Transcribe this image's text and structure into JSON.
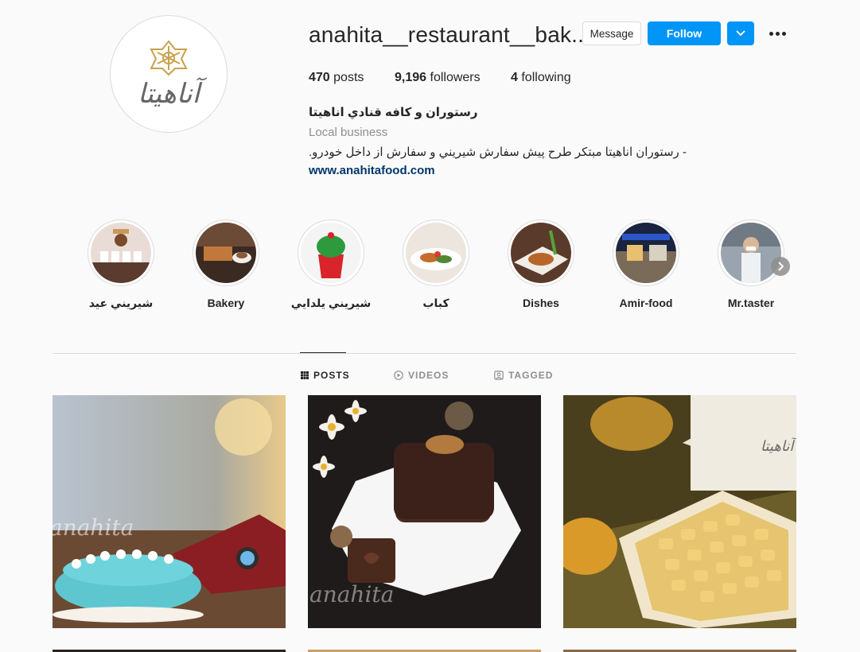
{
  "profile": {
    "username": "anahita__restaurant__bak...",
    "avatar_logo_text": "آناهیتا",
    "message_label": "Message",
    "follow_label": "Follow",
    "stats": {
      "posts_count": "470",
      "posts_label": "posts",
      "followers_count": "9,196",
      "followers_label": "followers",
      "following_count": "4",
      "following_label": "following"
    },
    "bio": {
      "name": "رستوران و كافه قنادي اناهيتا",
      "category": "Local business",
      "text": "- رستوران اناهيتا مبتكر طرح پيش سفارش شيريني و سفارش از داخل خودرو.",
      "link": "www.anahitafood.com"
    }
  },
  "highlights": [
    {
      "label": "شيريني عيد"
    },
    {
      "label": "Bakery"
    },
    {
      "label": "شيريني يلدايي"
    },
    {
      "label": "كباب"
    },
    {
      "label": "Dishes"
    },
    {
      "label": "Amir-food"
    },
    {
      "label": "Mr.taster"
    }
  ],
  "tabs": [
    {
      "label": "POSTS",
      "icon": "grid-icon",
      "active": true
    },
    {
      "label": "VIDEOS",
      "icon": "play-icon",
      "active": false
    },
    {
      "label": "TAGGED",
      "icon": "tag-icon",
      "active": false
    }
  ],
  "posts": [
    {
      "watermark": "anahita"
    },
    {
      "watermark": "anahita"
    },
    {
      "watermark": "آناهیتا"
    }
  ],
  "colors": {
    "accent": "#0095f6",
    "link": "#00376b",
    "muted": "#8e8e8e",
    "border": "#dbdbdb"
  }
}
